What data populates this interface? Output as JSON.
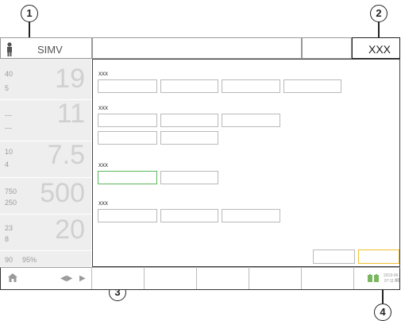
{
  "callouts": {
    "c1": "1",
    "c2": "2",
    "c3": "3",
    "c4": "4"
  },
  "header": {
    "mode": "SIMV",
    "right_label": "XXX"
  },
  "tiles": [
    {
      "small_top": "40",
      "small_bottom": "5",
      "big": "19"
    },
    {
      "small_top": "---",
      "small_bottom": "---",
      "big": "11"
    },
    {
      "small_top": "10",
      "small_bottom": "4",
      "big": "7.5"
    },
    {
      "small_top": "750",
      "small_bottom": "250",
      "big": "500"
    },
    {
      "small_top": "23",
      "small_bottom": "8",
      "big": "20"
    },
    {
      "small_top": "90",
      "small_bottom": "95%",
      "big": ""
    }
  ],
  "groups": [
    {
      "label": "xxx"
    },
    {
      "label": "xxx"
    },
    {
      "label": "xxx"
    },
    {
      "label": "xxx"
    }
  ],
  "status": {
    "date": "2019-06-07",
    "time": "07:11:56"
  },
  "colors": {
    "selected_field": "#5cb85c",
    "confirm_button": "#f0c030"
  },
  "icons": [
    "person-icon",
    "home-icon",
    "previous-icon",
    "next-icon",
    "battery-icon"
  ]
}
